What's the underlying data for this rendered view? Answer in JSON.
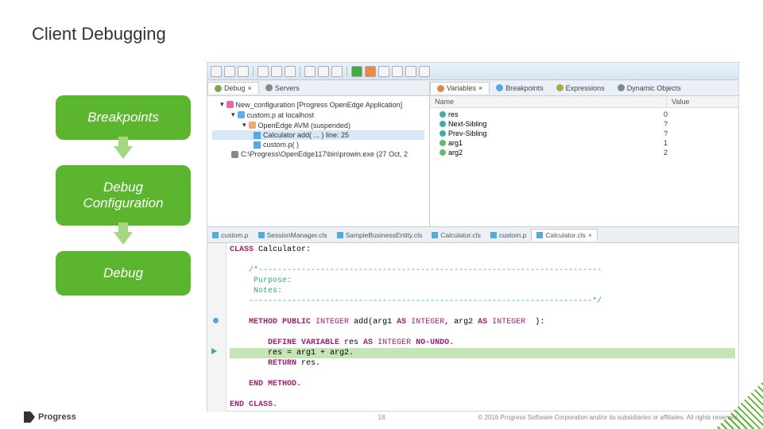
{
  "title": "Client Debugging",
  "steps": [
    "Breakpoints",
    "Debug Configuration",
    "Debug"
  ],
  "debugPanel": {
    "tabs": {
      "debug": "Debug",
      "servers": "Servers"
    },
    "tree": {
      "config": "New_configuration [Progress OpenEdge Application]",
      "proc": "custom.p at localhost",
      "thread": "OpenEdge AVM (suspended)",
      "frame1": "Calculator add( ... ) line: 25",
      "frame2": "custom.p( )",
      "exe": "C:\\Progress\\OpenEdge117\\bin\\prowin.exe (27 Oct, 2"
    }
  },
  "varsPanel": {
    "tabs": {
      "variables": "Variables",
      "breakpoints": "Breakpoints",
      "expressions": "Expressions",
      "dynamic": "Dynamic Objects"
    },
    "cols": {
      "name": "Name",
      "value": "Value"
    },
    "rows": [
      {
        "n": "res",
        "v": "0"
      },
      {
        "n": "Next-Sibling",
        "v": "?"
      },
      {
        "n": "Prev-Sibling",
        "v": "?"
      },
      {
        "n": "arg1",
        "v": "1"
      },
      {
        "n": "arg2",
        "v": "2"
      }
    ]
  },
  "editor": {
    "tabs": [
      "custom.p",
      "SessionManager.cls",
      "SampleBusinessEntity.cls",
      "Calculator.cls",
      "custom.p",
      "Calculator.cls"
    ],
    "activeTab": 5,
    "lines": {
      "l1": "CLASS Calculator:",
      "l2": "",
      "l3": "    /*------------------------------------------------------------------------",
      "l4": "     Purpose:",
      "l5": "     Notes:",
      "l6": "    ------------------------------------------------------------------------*/",
      "l7": "",
      "l8": "    METHOD PUBLIC INTEGER add(arg1 AS INTEGER, arg2 AS INTEGER  ):",
      "l9": "",
      "l10": "        DEFINE VARIABLE res AS INTEGER NO-UNDO.",
      "l11": "        res = arg1 + arg2.",
      "l12": "        RETURN res.",
      "l13": "",
      "l14": "    END METHOD.",
      "l15": "",
      "l16": "END CLASS."
    }
  },
  "footer": {
    "page": "18",
    "copyright": "© 2016 Progress Software Corporation and/or its subsidiaries or affiliates. All rights reserved.",
    "logo": "Progress"
  }
}
